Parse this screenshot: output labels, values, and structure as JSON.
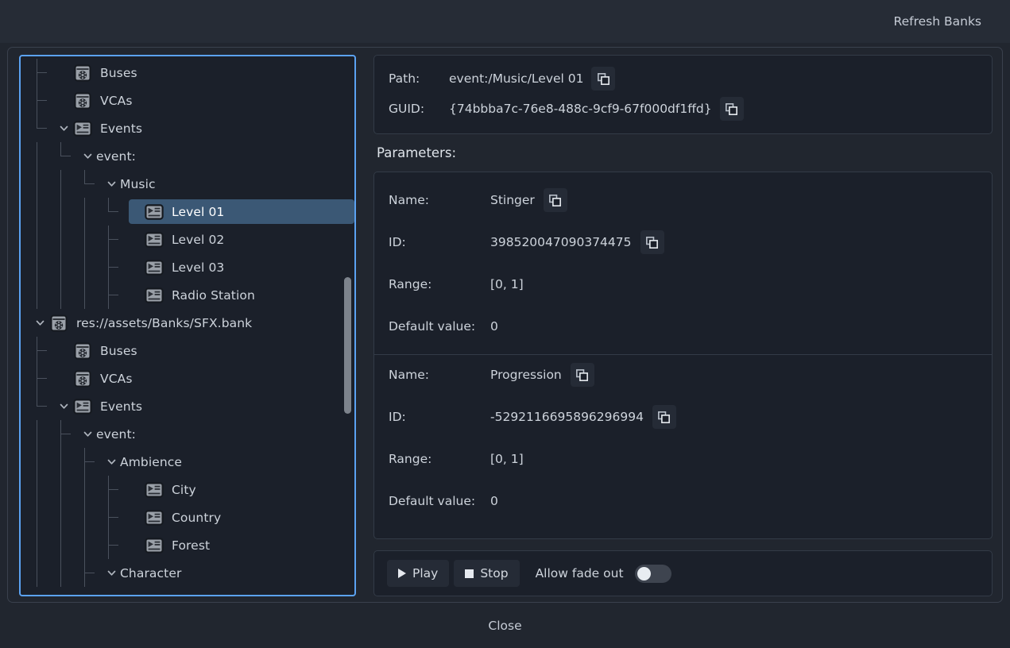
{
  "header": {
    "refresh_banks_label": "Refresh Banks"
  },
  "footer": {
    "close_label": "Close"
  },
  "colors": {
    "page_bg": "#21262f",
    "header_bg": "#262c36",
    "panel_bg": "#1b202a",
    "focus_border": "#5ba2f2",
    "selection_bg": "#3b5875",
    "text": "#cdd3db",
    "guide_line": "#4a515d",
    "scrollbar_thumb": "#7d838c"
  },
  "tree": {
    "scrollbar": "vertical-scrollbar",
    "selected_path": "event:/Music/Level 01",
    "nodes": [
      {
        "label": "Buses",
        "depth": 1,
        "icon": "bank-icon",
        "chevron": "none",
        "guide": "tee",
        "selected": false
      },
      {
        "label": "VCAs",
        "depth": 1,
        "icon": "bank-icon",
        "chevron": "none",
        "guide": "tee",
        "selected": false
      },
      {
        "label": "Events",
        "depth": 1,
        "icon": "event-icon",
        "chevron": "down",
        "guide": "elbow",
        "selected": false
      },
      {
        "label": "event:",
        "depth": 2,
        "icon": "none",
        "chevron": "down",
        "guide": "elbow",
        "selected": false
      },
      {
        "label": "Music",
        "depth": 3,
        "icon": "none",
        "chevron": "down",
        "guide": "elbow",
        "selected": false
      },
      {
        "label": "Level 01",
        "depth": 4,
        "icon": "event-icon",
        "chevron": "none",
        "guide": "elbow",
        "selected": true
      },
      {
        "label": "Level 02",
        "depth": 4,
        "icon": "event-icon",
        "chevron": "none",
        "guide": "tee",
        "selected": false
      },
      {
        "label": "Level 03",
        "depth": 4,
        "icon": "event-icon",
        "chevron": "none",
        "guide": "tee",
        "selected": false
      },
      {
        "label": "Radio Station",
        "depth": 4,
        "icon": "event-icon",
        "chevron": "none",
        "guide": "tee",
        "selected": false
      },
      {
        "label": "res://assets/Banks/SFX.bank",
        "depth": 0,
        "icon": "bank-icon",
        "chevron": "down",
        "guide": "none",
        "selected": false
      },
      {
        "label": "Buses",
        "depth": 1,
        "icon": "bank-icon",
        "chevron": "none",
        "guide": "tee",
        "selected": false
      },
      {
        "label": "VCAs",
        "depth": 1,
        "icon": "bank-icon",
        "chevron": "none",
        "guide": "tee",
        "selected": false
      },
      {
        "label": "Events",
        "depth": 1,
        "icon": "event-icon",
        "chevron": "down",
        "guide": "elbow",
        "selected": false
      },
      {
        "label": "event:",
        "depth": 2,
        "icon": "none",
        "chevron": "down",
        "guide": "tee",
        "selected": false
      },
      {
        "label": "Ambience",
        "depth": 3,
        "icon": "none",
        "chevron": "down",
        "guide": "tee",
        "selected": false
      },
      {
        "label": "City",
        "depth": 4,
        "icon": "event-icon",
        "chevron": "none",
        "guide": "tee",
        "selected": false
      },
      {
        "label": "Country",
        "depth": 4,
        "icon": "event-icon",
        "chevron": "none",
        "guide": "tee",
        "selected": false
      },
      {
        "label": "Forest",
        "depth": 4,
        "icon": "event-icon",
        "chevron": "none",
        "guide": "tee",
        "selected": false
      },
      {
        "label": "Character",
        "depth": 3,
        "icon": "none",
        "chevron": "down",
        "guide": "tee",
        "selected": false
      }
    ]
  },
  "details": {
    "path_key": "Path:",
    "path_value": "event:/Music/Level 01",
    "guid_key": "GUID:",
    "guid_value": "{74bbba7c-76e8-488c-9cf9-67f000df1ffd}",
    "copy_icon": "copy-icon"
  },
  "parameters_section": {
    "title": "Parameters:",
    "keys": {
      "name": "Name:",
      "id": "ID:",
      "range": "Range:",
      "default": "Default value:"
    },
    "items": [
      {
        "name": "Stinger",
        "id": "398520047090374475",
        "range": "[0, 1]",
        "default_value": "0"
      },
      {
        "name": "Progression",
        "id": "-5292116695896296994",
        "range": "[0, 1]",
        "default_value": "0"
      }
    ]
  },
  "playback": {
    "play_label": "Play",
    "stop_label": "Stop",
    "fade_label": "Allow fade out",
    "fade_enabled": false
  }
}
